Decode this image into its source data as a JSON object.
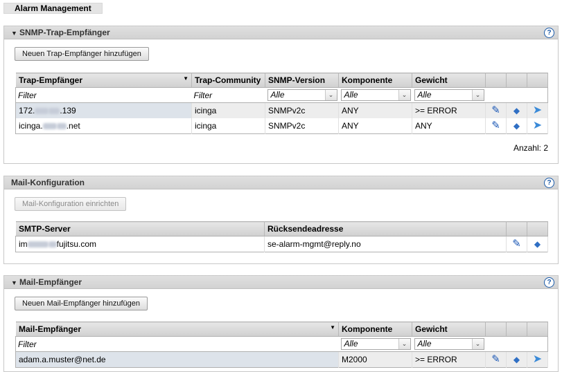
{
  "app": {
    "title": "Alarm Management"
  },
  "snmp": {
    "title": "SNMP-Trap-Empfänger",
    "add_button": "Neuen Trap-Empfänger hinzufügen",
    "columns": [
      "Trap-Empfänger",
      "Trap-Community",
      "SNMP-Version",
      "Komponente",
      "Gewicht"
    ],
    "filter_text": "Filter",
    "filter_alle": "Alle",
    "rows": [
      {
        "receiver_prefix": "172.",
        "receiver_suffix": ".139",
        "community": "icinga",
        "version": "SNMPv2c",
        "component": "ANY",
        "weight": ">= ERROR"
      },
      {
        "receiver_prefix": "icinga.",
        "receiver_suffix": ".net",
        "community": "icinga",
        "version": "SNMPv2c",
        "component": "ANY",
        "weight": "ANY"
      }
    ],
    "count": "Anzahl: 2"
  },
  "mailconf": {
    "title": "Mail-Konfiguration",
    "setup_button": "Mail-Konfiguration einrichten",
    "columns": [
      "SMTP-Server",
      "Rücksendeadresse"
    ],
    "rows": [
      {
        "server_prefix": "im",
        "server_suffix": "fujitsu.com",
        "return_address": "se-alarm-mgmt@reply.no"
      }
    ]
  },
  "mailrecv": {
    "title": "Mail-Empfänger",
    "add_button": "Neuen Mail-Empfänger hinzufügen",
    "columns": [
      "Mail-Empfänger",
      "Komponente",
      "Gewicht"
    ],
    "filter_text": "Filter",
    "filter_alle": "Alle",
    "rows": [
      {
        "recipient": "adam.a.muster@net.de",
        "component": "M2000",
        "weight": ">= ERROR"
      }
    ]
  },
  "icons": {
    "help": "question-circle-icon",
    "edit": "pencil-icon",
    "delete": "eraser-icon",
    "send": "send-arrow-icon",
    "collapse": "triangle-down-icon",
    "sort": "triangle-down-icon",
    "dropdown": "chevron-down-icon"
  },
  "colors": {
    "header_bg": "#d8d8d8",
    "row_alt": "#ededed",
    "icon_blue": "#1a57b5"
  }
}
